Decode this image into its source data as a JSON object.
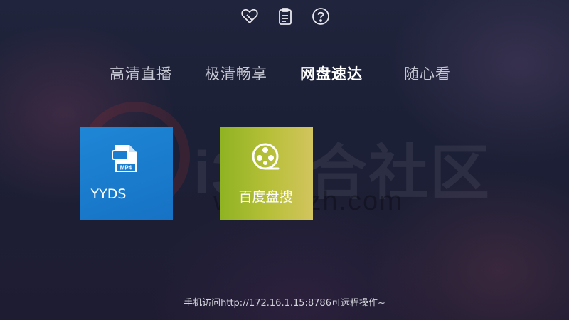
{
  "top_icons": [
    {
      "name": "favorite-icon",
      "label": "heart-with-pin"
    },
    {
      "name": "clipboard-icon",
      "label": "clipboard-list"
    },
    {
      "name": "help-icon",
      "label": "question-circle"
    }
  ],
  "tabs": [
    {
      "label": "高清直播",
      "active": false
    },
    {
      "label": "极清畅享",
      "active": false
    },
    {
      "label": "网盘速达",
      "active": true
    },
    {
      "label": "随心看",
      "active": false
    }
  ],
  "tiles": [
    {
      "label": "YYDS",
      "icon": "mp4-file-icon",
      "color": "#1a7dd0"
    },
    {
      "label": "百度盘搜",
      "icon": "film-reel-icon",
      "color": "#b0bd35"
    }
  ],
  "watermark": {
    "text": "i3综合社区",
    "url": "www.i3zh.com"
  },
  "footer": {
    "text": "手机访问http://172.16.1.15:8786可远程操作~"
  }
}
